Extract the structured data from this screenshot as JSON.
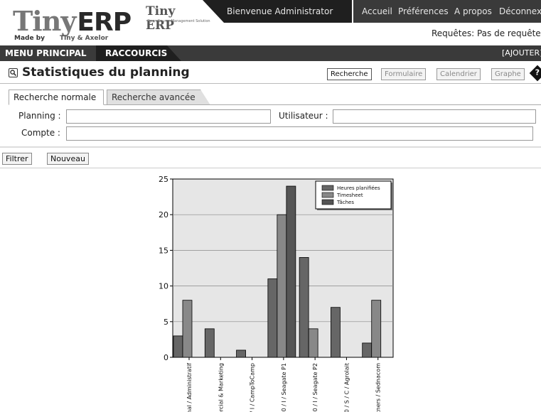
{
  "header": {
    "logo_tiny": "Tiny",
    "logo_erp": "ERP",
    "logo_madeby": "Made by",
    "logo_partner": "Tiny & Axelor",
    "mini_logo": "Tiny ERP",
    "mini_logo_sub": "Open Source Management Solution",
    "welcome": "Bienvenue Administrator",
    "links": [
      "Accueil",
      "Préférences",
      "A propos",
      "Déconnexion"
    ],
    "requests": "Requêtes: Pas de requête"
  },
  "menubar": {
    "main_menu": "MENU PRINCIPAL",
    "shortcuts": "RACCOURCIS",
    "add": "[AJOUTER]"
  },
  "page": {
    "title": "Statistiques du planning",
    "views": [
      "Recherche",
      "Formulaire",
      "Calendrier",
      "Graphe"
    ],
    "active_view": "Recherche"
  },
  "search": {
    "tabs": [
      "Recherche normale",
      "Recherche avancée"
    ],
    "active_tab": "Recherche normale",
    "fields": {
      "planning_label": "Planning :",
      "planning_value": "",
      "user_label": "Utilisateur :",
      "user_value": "",
      "account_label": "Compte :",
      "account_value": ""
    }
  },
  "actions": {
    "filter": "Filtrer",
    "new": "Nouveau"
  },
  "chart_data": {
    "type": "bar",
    "categories": [
      "mal / Administratif",
      "ercial & Marketing",
      "/ I / CampToCamp",
      "0 / I / Seagate P1",
      "0 / I / Seagate P2",
      "0 / S / C / Agrolait",
      "rtners / Sednacom"
    ],
    "series": [
      {
        "name": "Heures planifiées",
        "color": "#666666",
        "values": [
          3,
          4,
          1,
          11,
          14,
          7,
          2
        ]
      },
      {
        "name": "Timesheet",
        "color": "#888888",
        "values": [
          8,
          0,
          0,
          20,
          4,
          0,
          8
        ]
      },
      {
        "name": "Tâches",
        "color": "#555555",
        "values": [
          0,
          0,
          0,
          24,
          0,
          0,
          0
        ]
      }
    ],
    "ylim": [
      0,
      25
    ],
    "yticks": [
      0,
      5,
      10,
      15,
      20,
      25
    ],
    "grid": true,
    "legend": "top-right",
    "title": "",
    "xlabel": "",
    "ylabel": ""
  }
}
